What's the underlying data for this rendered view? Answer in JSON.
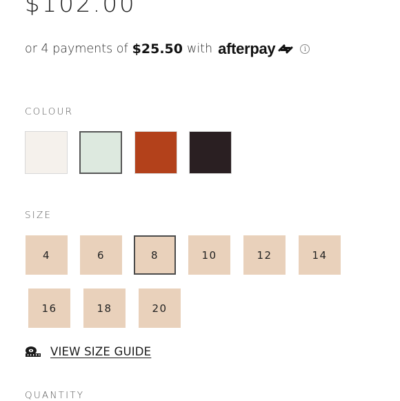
{
  "product": {
    "price": "$102.00"
  },
  "afterpay": {
    "prefix": "or 4 payments of",
    "amount": "$25.50",
    "with": "with",
    "brand": "afterpay",
    "info_glyph": "i"
  },
  "colour": {
    "label": "COLOUR",
    "swatches": [
      {
        "color": "#f5f1ec",
        "selected": false
      },
      {
        "color": "#dde9df",
        "selected": true
      },
      {
        "color": "#b3411b",
        "selected": false
      },
      {
        "color": "#2a1f22",
        "selected": false
      }
    ]
  },
  "size": {
    "label": "SIZE",
    "options": [
      "4",
      "6",
      "8",
      "10",
      "12",
      "14",
      "16",
      "18",
      "20"
    ],
    "selected": "8"
  },
  "size_guide": {
    "label": "VIEW SIZE GUIDE",
    "icon": "measuring-tape-icon"
  },
  "quantity": {
    "label": "QUANTITY"
  },
  "colors": {
    "size_fill": "#e9d1bb",
    "text": "#1f1f1f"
  }
}
